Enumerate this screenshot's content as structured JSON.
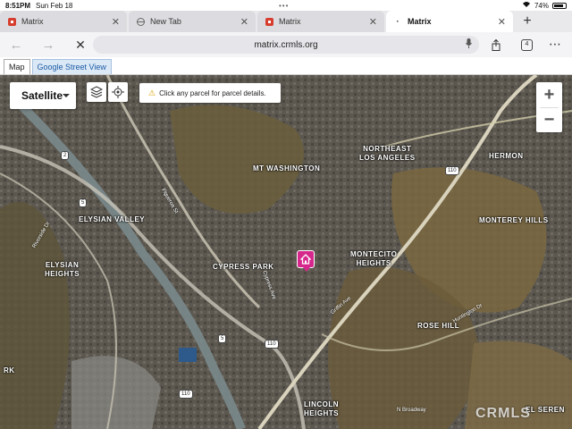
{
  "status": {
    "time": "8:51PM",
    "date": "Sun Feb 18",
    "battery": "74%"
  },
  "tabs": [
    {
      "title": "Matrix",
      "favicon": "matrix-icon",
      "active": false
    },
    {
      "title": "New Tab",
      "favicon": "globe-icon",
      "active": false
    },
    {
      "title": "Matrix",
      "favicon": "matrix-icon",
      "active": false
    },
    {
      "title": "Matrix",
      "favicon": "matrix-icon",
      "active": true
    }
  ],
  "addressbar": {
    "url": "matrix.crmls.org",
    "tab_count": "4"
  },
  "map_tabs": {
    "map": "Map",
    "street_view": "Google Street View"
  },
  "map": {
    "type_selector": "Satellite",
    "notice": "Click any parcel for parcel details.",
    "labels": [
      {
        "id": "mt-washington",
        "text": "MT WASHINGTON"
      },
      {
        "id": "northeast-la",
        "text": "NORTHEAST\nLOS ANGELES"
      },
      {
        "id": "hermon",
        "text": "HERMON"
      },
      {
        "id": "elysian-valley",
        "text": "ELYSIAN VALLEY"
      },
      {
        "id": "monterey-hills",
        "text": "MONTEREY HILLS"
      },
      {
        "id": "elysian-heights",
        "text": "ELYSIAN\nHEIGHTS"
      },
      {
        "id": "cypress-park",
        "text": "CYPRESS PARK"
      },
      {
        "id": "montecito-heights",
        "text": "MONTECITO\nHEIGHTS"
      },
      {
        "id": "rose-hill",
        "text": "ROSE HILL"
      },
      {
        "id": "lincoln-heights",
        "text": "LINCOLN\nHEIGHTS"
      },
      {
        "id": "el-sereno",
        "text": "EL SEREN"
      },
      {
        "id": "park",
        "text": "RK"
      }
    ],
    "roads": [
      "Figueroa St",
      "Cypress Ave",
      "Griffin Ave",
      "Huntington Dr",
      "N Broadway",
      "Riverside Dr"
    ],
    "shields": [
      "110",
      "2",
      "5",
      "110",
      "5",
      "110"
    ],
    "watermark": "CRMLS"
  }
}
